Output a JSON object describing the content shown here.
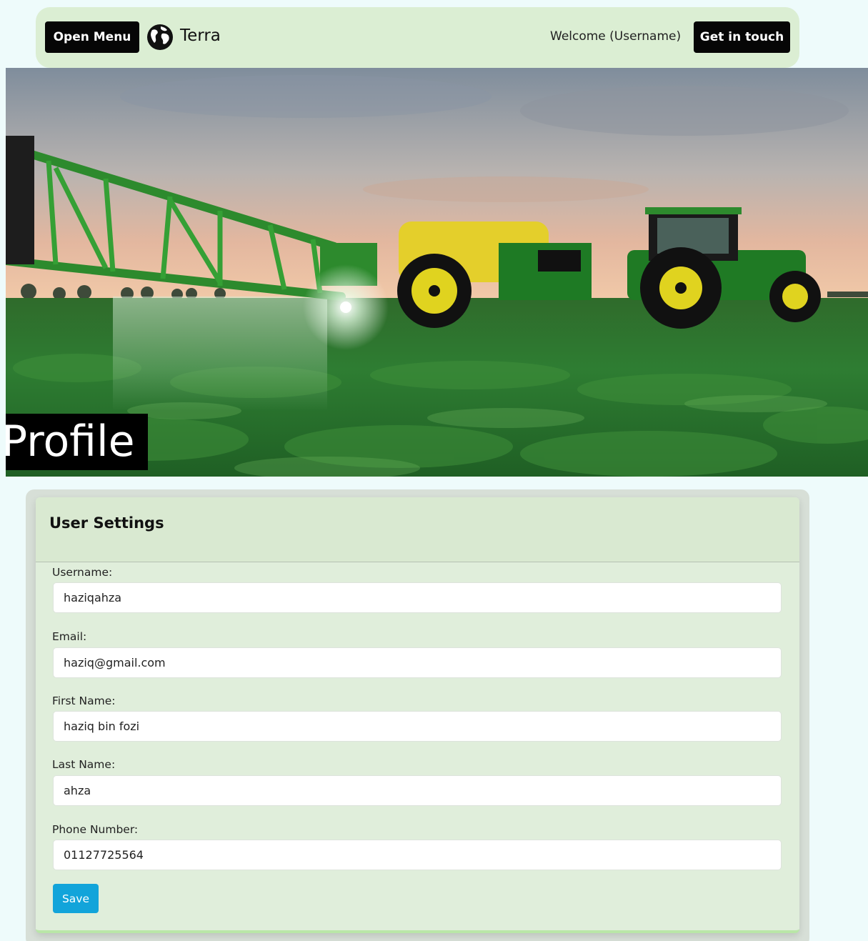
{
  "navbar": {
    "menu_button": "Open Menu",
    "brand": "Terra",
    "brand_icon": "globe-icon",
    "welcome": "Welcome (Username)",
    "contact_button": "Get in touch"
  },
  "hero": {
    "title": "Profile",
    "image": "tractor-spraying-field-photo"
  },
  "settings": {
    "title": "User Settings",
    "fields": [
      {
        "label": "Username:",
        "value": "haziqahza"
      },
      {
        "label": "Email:",
        "value": "haziq@gmail.com"
      },
      {
        "label": "First Name:",
        "value": "haziq bin fozi"
      },
      {
        "label": "Last Name:",
        "value": "ahza"
      },
      {
        "label": "Phone Number:",
        "value": "01127725564"
      }
    ],
    "save_button": "Save"
  },
  "colors": {
    "navbar_bg": "#dbeed3",
    "card_bg": "#e0eedb",
    "save_button": "#12a4da",
    "dark_button": "#060606",
    "page_bg": "#eefbfb"
  }
}
